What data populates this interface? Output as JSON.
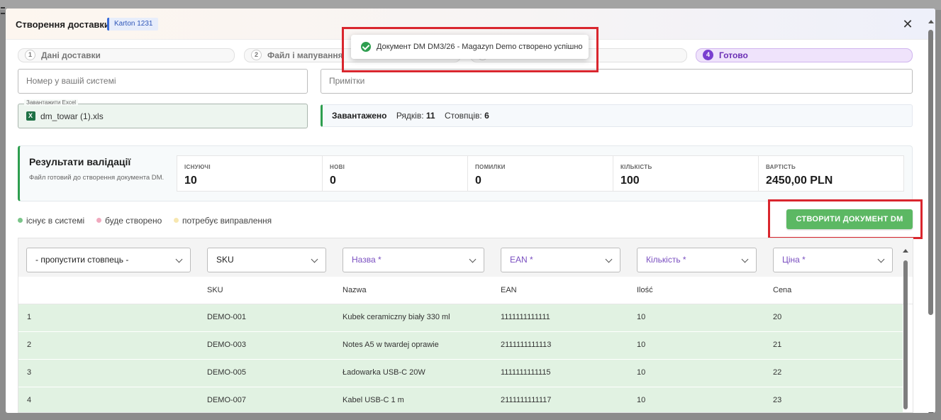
{
  "modal": {
    "title": "Створення доставки",
    "badge": "Karton 1231",
    "close_icon": "close-icon"
  },
  "steps": [
    {
      "num": "1",
      "label": "Дані доставки",
      "active": false
    },
    {
      "num": "2",
      "label": "Файл і мапування",
      "active": false
    },
    {
      "num": "3",
      "label": "",
      "active": false
    },
    {
      "num": "4",
      "label": "Готово",
      "active": true
    }
  ],
  "toast": {
    "icon": "check-circle-icon",
    "message": "Документ DM DM3/26 - Magazyn Demo створено успішно"
  },
  "form": {
    "system_number_placeholder": "Номер у вашій системі",
    "notes_placeholder": "Примітки",
    "upload_label": "Завантажити Excel",
    "upload_file": "dm_towar (1).xls",
    "upload_icon": "excel-file-icon"
  },
  "loaded": {
    "status": "Завантажено",
    "rows_label": "Рядків:",
    "rows_value": "11",
    "cols_label": "Стовпців:",
    "cols_value": "6"
  },
  "validation": {
    "title": "Результати валідації",
    "subtitle": "Файл готовий до створення документа DM.",
    "stats": [
      {
        "label": "ІСНУЮЧІ",
        "value": "10"
      },
      {
        "label": "НОВІ",
        "value": "0"
      },
      {
        "label": "ПОМИЛКИ",
        "value": "0"
      },
      {
        "label": "КІЛЬКІСТЬ",
        "value": "100"
      },
      {
        "label": "ВАРТІСТЬ",
        "value": "2450,00 PLN"
      }
    ]
  },
  "legend": [
    {
      "label": "існує в системі",
      "color": "#7bc58a"
    },
    {
      "label": "буде створено",
      "color": "#f0a9be"
    },
    {
      "label": "потребує виправлення",
      "color": "#f7e7b0"
    }
  ],
  "create_button": "СТВОРИТИ ДОКУМЕНТ DM",
  "table": {
    "mapping": [
      {
        "label": "- пропустити стовпець -",
        "required": false
      },
      {
        "label": "SKU",
        "required": false
      },
      {
        "label": "Назва *",
        "required": true
      },
      {
        "label": "EAN *",
        "required": true
      },
      {
        "label": "Кількість *",
        "required": true
      },
      {
        "label": "Ціна *",
        "required": true
      }
    ],
    "headers": [
      "",
      "SKU",
      "Nazwa",
      "EAN",
      "Ilość",
      "Cena"
    ],
    "rows": [
      [
        "1",
        "DEMO-001",
        "Kubek ceramiczny biały 330 ml",
        "1111111111111",
        "10",
        "20"
      ],
      [
        "2",
        "DEMO-003",
        "Notes A5 w twardej oprawie",
        "2111111111113",
        "10",
        "21"
      ],
      [
        "3",
        "DEMO-005",
        "Ładowarka USB-C 20W",
        "1111111111115",
        "10",
        "22"
      ],
      [
        "4",
        "DEMO-007",
        "Kabel USB-C 1 m",
        "2111111111117",
        "10",
        "23"
      ]
    ]
  },
  "colors": {
    "accent_green": "#5cb863",
    "row_green": "#e1f2e2",
    "active_step": "#7a3fd0",
    "highlight_red": "#d9262e"
  }
}
